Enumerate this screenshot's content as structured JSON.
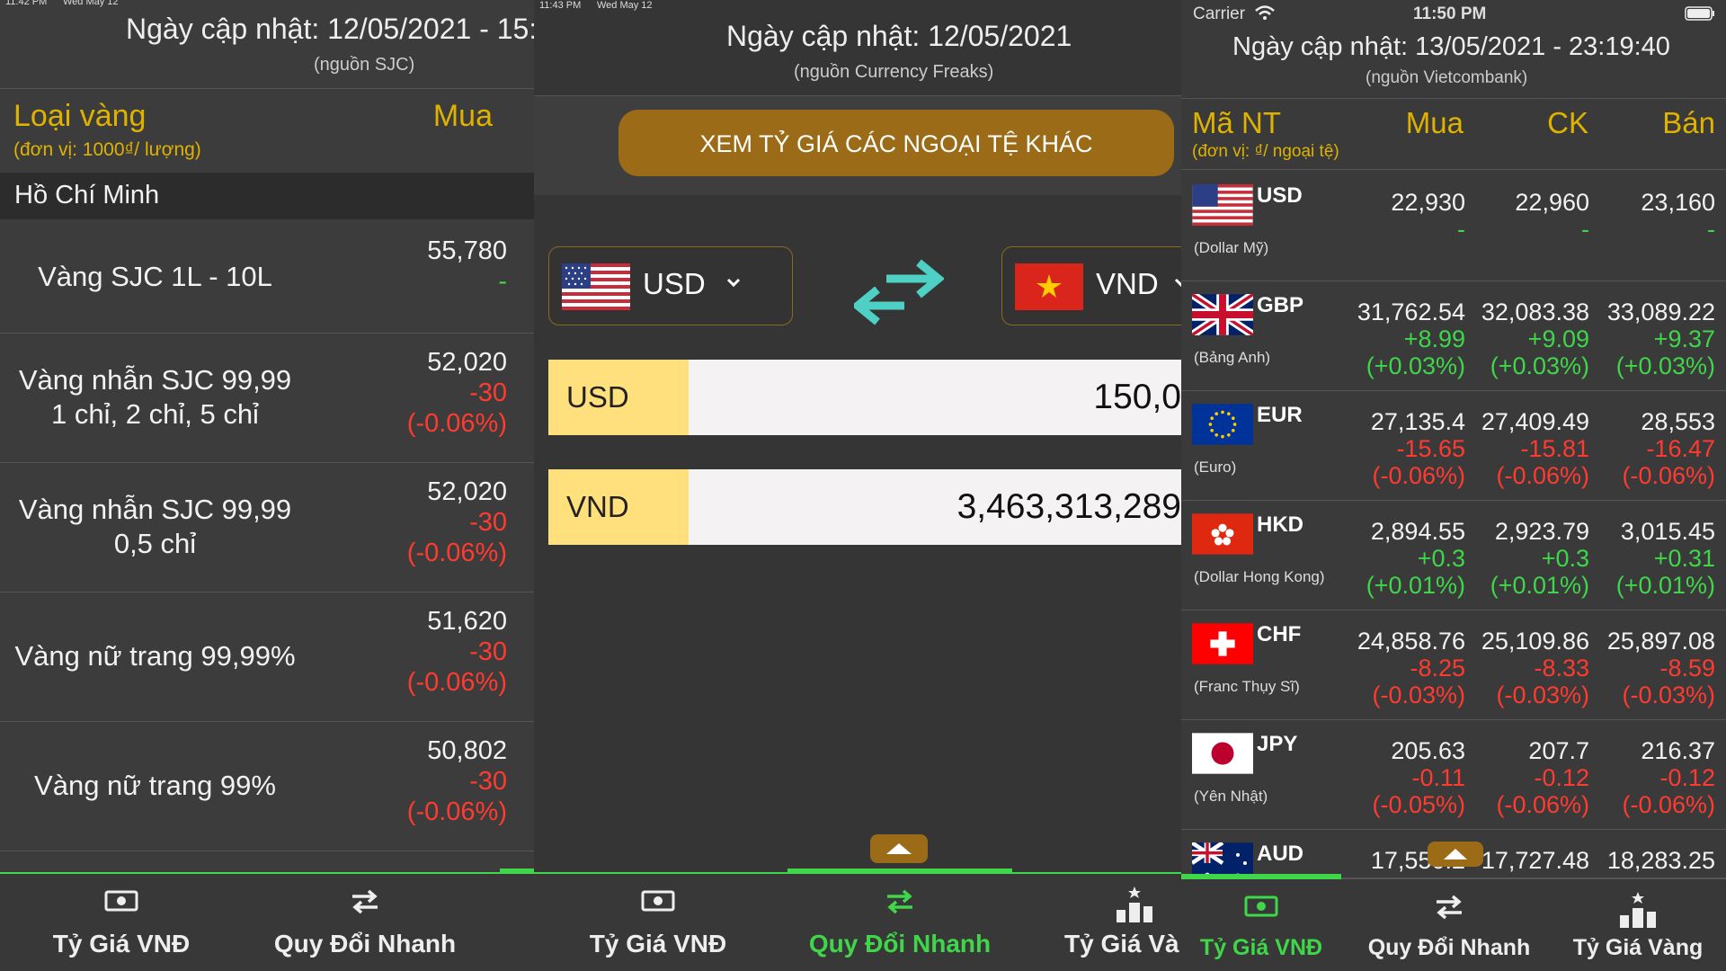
{
  "left": {
    "status_time": "11:42 PM",
    "status_date": "Wed May 12",
    "update_text": "Ngày cập nhật: 12/05/2021 - 15:",
    "source": "(nguồn SJC)",
    "col_type": "Loại vàng",
    "col_unit": "(đơn vị: 1000₫/ lượng)",
    "col_buy": "Mua",
    "region": "Hồ Chí Minh",
    "rows": [
      {
        "name": "Vàng SJC 1L - 10L",
        "value": "55,780",
        "change": "-",
        "pct": "",
        "dir": "green"
      },
      {
        "name": "Vàng nhẫn SJC 99,99\n1 chỉ, 2 chỉ, 5 chỉ",
        "value": "52,020",
        "change": "-30",
        "pct": "(-0.06%)",
        "dir": "red"
      },
      {
        "name": "Vàng nhẫn SJC 99,99\n0,5 chỉ",
        "value": "52,020",
        "change": "-30",
        "pct": "(-0.06%)",
        "dir": "red"
      },
      {
        "name": "Vàng nữ trang 99,99%",
        "value": "51,620",
        "change": "-30",
        "pct": "(-0.06%)",
        "dir": "red"
      },
      {
        "name": "Vàng nữ trang 99%",
        "value": "50,802",
        "change": "-30",
        "pct": "(-0.06%)",
        "dir": "red"
      }
    ],
    "tabs": [
      {
        "label": "Tỷ Giá VNĐ",
        "icon": "banknote-icon"
      },
      {
        "label": "Quy Đổi Nhanh",
        "icon": "swap-icon"
      }
    ]
  },
  "middle": {
    "status_time": "11:43 PM",
    "status_date": "Wed May 12",
    "update_text": "Ngày cập nhật: 12/05/2021",
    "source": "(nguồn Currency Freaks)",
    "other_button": "XEM TỶ GIÁ CÁC NGOẠI TỆ KHÁC",
    "from_code": "USD",
    "to_code": "VND",
    "from_label": "USD",
    "from_value": "150,0",
    "to_label": "VND",
    "to_value": "3,463,313,289",
    "tabs": [
      {
        "label": "Tỷ Giá VNĐ",
        "icon": "banknote-icon"
      },
      {
        "label": "Quy Đổi Nhanh",
        "icon": "swap-icon"
      },
      {
        "label": "Tỷ Giá Và",
        "icon": "podium-icon"
      }
    ],
    "colors": {
      "accent": "#3fd64a",
      "button": "#9b6b17",
      "label_bg": "#ffe07c"
    }
  },
  "right": {
    "carrier": "Carrier",
    "status_time": "11:50 PM",
    "update_text": "Ngày cập nhật: 13/05/2021 - 23:19:40",
    "source": "(nguồn Vietcombank)",
    "col_code": "Mã NT",
    "col_unit": "(đơn vị: ₫/ ngoại tệ)",
    "col_buy": "Mua",
    "col_ck": "CK",
    "col_sell": "Bán",
    "rows": [
      {
        "code": "USD",
        "name": "(Dollar Mỹ)",
        "flag": "us",
        "buy": {
          "v": "22,930",
          "c": "-",
          "p": ""
        },
        "ck": {
          "v": "22,960",
          "c": "-",
          "p": ""
        },
        "sell": {
          "v": "23,160",
          "c": "-",
          "p": ""
        },
        "dir": "green"
      },
      {
        "code": "GBP",
        "name": "(Bảng Anh)",
        "flag": "gb",
        "buy": {
          "v": "31,762.54",
          "c": "+8.99",
          "p": "(+0.03%)"
        },
        "ck": {
          "v": "32,083.38",
          "c": "+9.09",
          "p": "(+0.03%)"
        },
        "sell": {
          "v": "33,089.22",
          "c": "+9.37",
          "p": "(+0.03%)"
        },
        "dir": "green"
      },
      {
        "code": "EUR",
        "name": "(Euro)",
        "flag": "eu",
        "buy": {
          "v": "27,135.4",
          "c": "-15.65",
          "p": "(-0.06%)"
        },
        "ck": {
          "v": "27,409.49",
          "c": "-15.81",
          "p": "(-0.06%)"
        },
        "sell": {
          "v": "28,553",
          "c": "-16.47",
          "p": "(-0.06%)"
        },
        "dir": "red"
      },
      {
        "code": "HKD",
        "name": "(Dollar Hong Kong)",
        "flag": "hk",
        "buy": {
          "v": "2,894.55",
          "c": "+0.3",
          "p": "(+0.01%)"
        },
        "ck": {
          "v": "2,923.79",
          "c": "+0.3",
          "p": "(+0.01%)"
        },
        "sell": {
          "v": "3,015.45",
          "c": "+0.31",
          "p": "(+0.01%)"
        },
        "dir": "green"
      },
      {
        "code": "CHF",
        "name": "(Franc Thụy Sĩ)",
        "flag": "ch",
        "buy": {
          "v": "24,858.76",
          "c": "-8.25",
          "p": "(-0.03%)"
        },
        "ck": {
          "v": "25,109.86",
          "c": "-8.33",
          "p": "(-0.03%)"
        },
        "sell": {
          "v": "25,897.08",
          "c": "-8.59",
          "p": "(-0.03%)"
        },
        "dir": "red"
      },
      {
        "code": "JPY",
        "name": "(Yên Nhật)",
        "flag": "jp",
        "buy": {
          "v": "205.63",
          "c": "-0.11",
          "p": "(-0.05%)"
        },
        "ck": {
          "v": "207.7",
          "c": "-0.12",
          "p": "(-0.06%)"
        },
        "sell": {
          "v": "216.37",
          "c": "-0.12",
          "p": "(-0.06%)"
        },
        "dir": "red"
      },
      {
        "code": "AUD",
        "name": "",
        "flag": "au",
        "buy": {
          "v": "17,550.2",
          "c": "",
          "p": ""
        },
        "ck": {
          "v": "17,727.48",
          "c": "",
          "p": ""
        },
        "sell": {
          "v": "18,283.25",
          "c": "",
          "p": ""
        },
        "dir": "green"
      }
    ],
    "tabs": [
      {
        "label": "Tỷ Giá VNĐ",
        "icon": "banknote-icon"
      },
      {
        "label": "Quy Đổi Nhanh",
        "icon": "swap-icon"
      },
      {
        "label": "Tỷ Giá Vàng",
        "icon": "podium-icon"
      }
    ]
  }
}
